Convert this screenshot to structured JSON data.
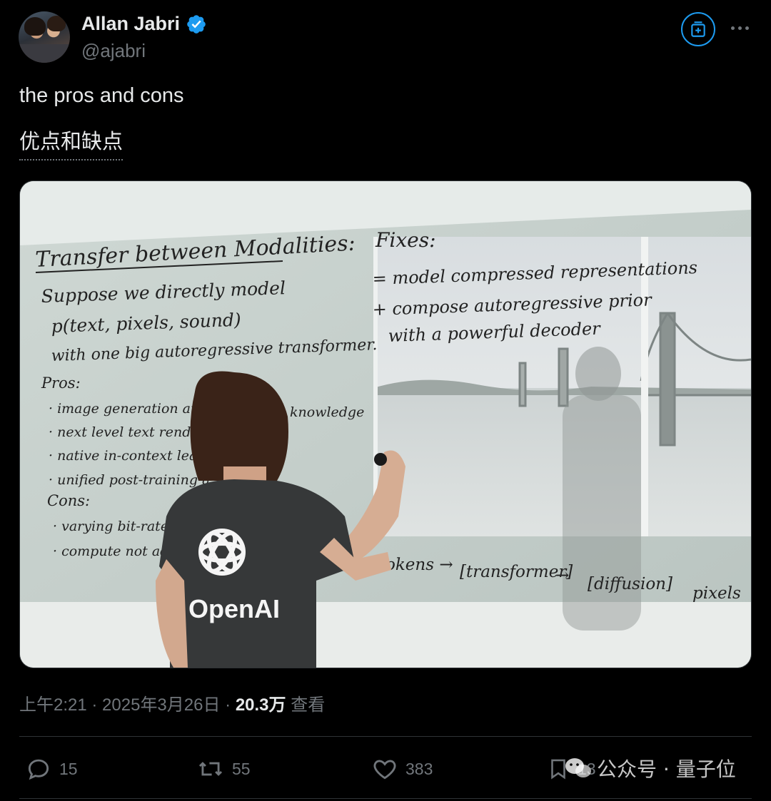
{
  "author": {
    "name": "Allan Jabri",
    "handle": "@ajabri",
    "verified": true
  },
  "tweet": {
    "text": "the pros and cons",
    "translation": "优点和缺点"
  },
  "media": {
    "whiteboard": {
      "title": "Transfer between Modalities:",
      "line1": "Suppose we directly model",
      "line2": "p(text, pixels, sound)",
      "line3": "with one big autoregressive transformer.",
      "pros_label": "Pros:",
      "pro1": "· image generation augmented",
      "pro1_tail": "knowledge",
      "pro2": "· next level text renderin",
      "pro3": "· native in-context lear",
      "pro4": "· unified post-training a",
      "cons_label": "Cons:",
      "con1": "· varying bit-rate a",
      "con2": "· compute not ada",
      "fixes_label": "Fixes:",
      "fix1": "= model compressed representations",
      "fix2": "+ compose autoregressive prior",
      "fix3": "with a powerful decoder",
      "pipeline_tokens": "okens →",
      "pipeline_transformer": "[transformer]",
      "pipeline_arrow": "→",
      "pipeline_diffusion": "[diffusion]",
      "pipeline_pixels": "pixels"
    },
    "shirt_logo_text": "OpenAI"
  },
  "meta": {
    "time": "上午2:21",
    "sep1": " · ",
    "date": "2025年3月26日",
    "sep2": " · ",
    "views": "20.3万",
    "views_label": " 查看"
  },
  "actions": {
    "replies": "15",
    "reposts": "55",
    "likes": "383",
    "bookmarks": "13"
  },
  "watermark": {
    "source": "公众号 · 量子位"
  },
  "colors": {
    "accent": "#1d9bf0",
    "muted": "#71767b",
    "text": "#e7e9ea",
    "background": "#000000"
  },
  "icons": [
    "verified-badge-icon",
    "subscribe-icon",
    "more-icon",
    "reply-icon",
    "repost-icon",
    "like-icon",
    "bookmark-icon",
    "wechat-icon"
  ]
}
